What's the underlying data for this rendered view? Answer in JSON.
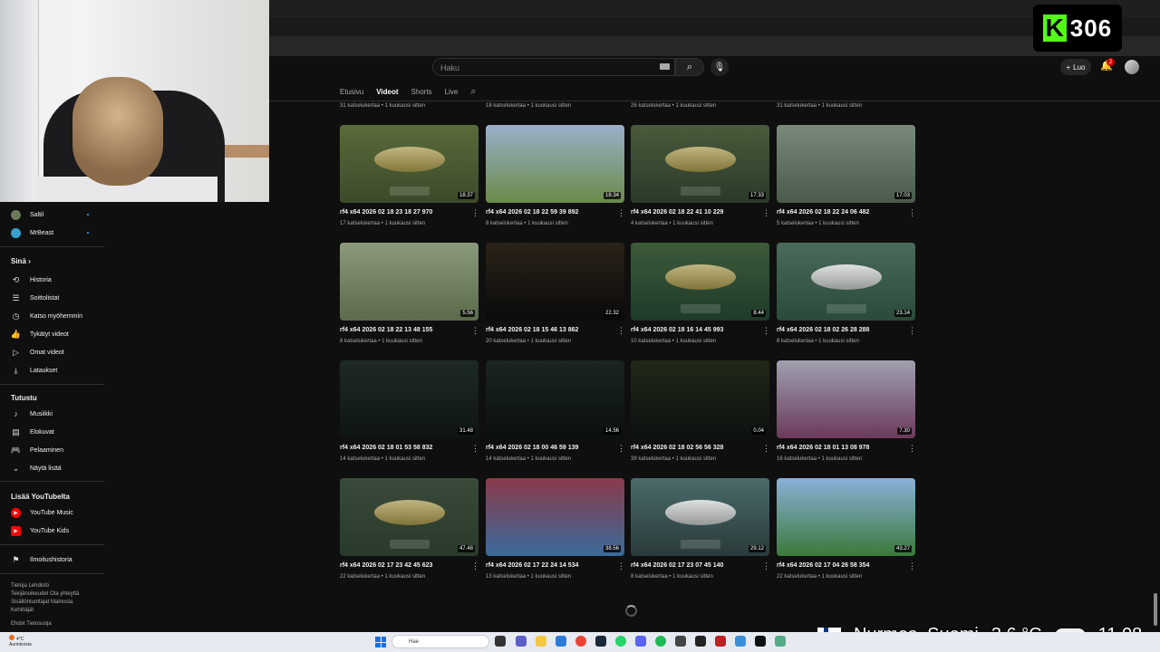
{
  "kick": {
    "count": "306",
    "logo": "K"
  },
  "search": {
    "placeholder": "Haku"
  },
  "header": {
    "create_label": "Luo",
    "notification_count": "2"
  },
  "channel_tabs": [
    "Etusivu",
    "Videot",
    "Shorts",
    "Live"
  ],
  "active_tab": "Videot",
  "prev_row_meta": [
    "31 katselukertaa • 1 kuukausi sitten",
    "18 katselukertaa • 1 kuukausi sitten",
    "26 katselukertaa • 1 kuukausi sitten",
    "31 katselukertaa • 1 kuukausi sitten"
  ],
  "videos": [
    {
      "title": "rf4 x64 2026 02 18 23 18 27 970",
      "meta": "17 katselukertaa • 1 kuukausi sitten",
      "duration": "18.37"
    },
    {
      "title": "rf4 x64 2026 02 18 22 59 39 892",
      "meta": "8 katselukertaa • 1 kuukausi sitten",
      "duration": "18.34"
    },
    {
      "title": "rf4 x64 2026 02 18 22 41 10 229",
      "meta": "4 katselukertaa • 1 kuukausi sitten",
      "duration": "17.33"
    },
    {
      "title": "rf4 x64 2026 02 18 22 24 06 482",
      "meta": "5 katselukertaa • 1 kuukausi sitten",
      "duration": "17.03"
    },
    {
      "title": "rf4 x64 2026 02 18 22 13 48 155",
      "meta": "8 katselukertaa • 1 kuukausi sitten",
      "duration": "5.56"
    },
    {
      "title": "rf4 x64 2026 02 18 15 46 13 862",
      "meta": "20 katselukertaa • 1 kuukausi sitten",
      "duration": "22.32"
    },
    {
      "title": "rf4 x64 2026 02 18 16 14 45 993",
      "meta": "10 katselukertaa • 1 kuukausi sitten",
      "duration": "8.44"
    },
    {
      "title": "rf4 x64 2026 02 18 02 26 28 288",
      "meta": "8 katselukertaa • 1 kuukausi sitten",
      "duration": "23.14"
    },
    {
      "title": "rf4 x64 2026 02 18 01 53 58 832",
      "meta": "14 katselukertaa • 1 kuukausi sitten",
      "duration": "31.48"
    },
    {
      "title": "rf4 x64 2026 02 18 00 46 59 139",
      "meta": "14 katselukertaa • 1 kuukausi sitten",
      "duration": "14.56"
    },
    {
      "title": "rf4 x64 2026 02 18 02 56 56 328",
      "meta": "39 katselukertaa • 1 kuukausi sitten",
      "duration": "0.04"
    },
    {
      "title": "rf4 x64 2026 02 18 01 13 08 978",
      "meta": "16 katselukertaa • 1 kuukausi sitten",
      "duration": "7.30"
    },
    {
      "title": "rf4 x64 2026 02 17 23 42 45 623",
      "meta": "22 katselukertaa • 1 kuukausi sitten",
      "duration": "47.48"
    },
    {
      "title": "rf4 x64 2026 02 17 22 24 14 534",
      "meta": "13 katselukertaa • 1 kuukausi sitten",
      "duration": "38.56"
    },
    {
      "title": "rf4 x64 2026 02 17 23 07 45 140",
      "meta": "8 katselukertaa • 1 kuukausi sitten",
      "duration": "29.12"
    },
    {
      "title": "rf4 x64 2026 02 17 04 26 58 354",
      "meta": "22 katselukertaa • 1 kuukausi sitten",
      "duration": "43.27"
    }
  ],
  "sidebar": {
    "subscriptions": [
      "Saltil",
      "MrBeast"
    ],
    "you_heading": "Sinä",
    "you_items": [
      "Historia",
      "Soittolistat",
      "Katso myöhemmin",
      "Tykätyt videot",
      "Omat videot",
      "Lataukset"
    ],
    "explore_heading": "Tutustu",
    "explore_items": [
      "Musiikki",
      "Elokuvat",
      "Pelaaminen",
      "Näytä lisää"
    ],
    "more_heading": "Lisää YouTubelta",
    "more_items": [
      "YouTube Music",
      "YouTube Kids"
    ],
    "report_history": "Ilmoitushistoria",
    "footer_1": "Tietoja  Lehdistö\nTekijänoikeudet  Ota yhteyttä\nSisällöntuottajat  Mainosta\nKehittäjät",
    "footer_2": "Ehdot  Tietosuoja"
  },
  "taskbar": {
    "weather_temp": "4°C",
    "weather_desc": "Aurinkoista",
    "search_placeholder": "Hae"
  },
  "overlay": {
    "location": "Nurmes, Suomi",
    "temperature": "3.6 °C",
    "time": "11.08"
  }
}
